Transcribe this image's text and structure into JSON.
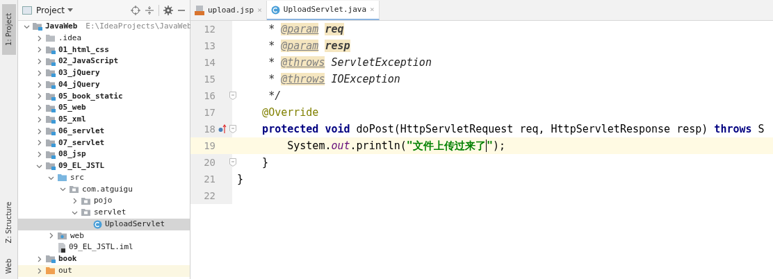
{
  "side_tabs": [
    {
      "label": "1: Project",
      "selected": true
    },
    {
      "label": "Z: Structure",
      "selected": false
    },
    {
      "label": "Web",
      "selected": false
    }
  ],
  "project_panel": {
    "title": "Project",
    "tree": [
      {
        "label": "JavaWeb",
        "path": "E:\\IdeaProjects\\JavaWeb",
        "kind": "module",
        "expanded": true,
        "selected": false,
        "children": [
          {
            "label": ".idea",
            "kind": "folder",
            "expanded": false,
            "selected": false
          },
          {
            "label": "01_html_css",
            "kind": "module",
            "expanded": false,
            "selected": false
          },
          {
            "label": "02_JavaScript",
            "kind": "module",
            "expanded": false,
            "selected": false
          },
          {
            "label": "03_jQuery",
            "kind": "module",
            "expanded": false,
            "selected": false
          },
          {
            "label": "04_jQuery",
            "kind": "module",
            "expanded": false,
            "selected": false
          },
          {
            "label": "05_book_static",
            "kind": "module",
            "expanded": false,
            "selected": false
          },
          {
            "label": "05_web",
            "kind": "module",
            "expanded": false,
            "selected": false
          },
          {
            "label": "05_xml",
            "kind": "module",
            "expanded": false,
            "selected": false
          },
          {
            "label": "06_servlet",
            "kind": "module",
            "expanded": false,
            "selected": false
          },
          {
            "label": "07_servlet",
            "kind": "module",
            "expanded": false,
            "selected": false
          },
          {
            "label": "08_jsp",
            "kind": "module",
            "expanded": false,
            "selected": false
          },
          {
            "label": "09_EL_JSTL",
            "kind": "module",
            "expanded": true,
            "selected": false,
            "children": [
              {
                "label": "src",
                "kind": "source",
                "expanded": true,
                "selected": false,
                "children": [
                  {
                    "label": "com.atguigu",
                    "kind": "package",
                    "expanded": true,
                    "selected": false,
                    "children": [
                      {
                        "label": "pojo",
                        "kind": "package",
                        "expanded": false,
                        "selected": false
                      },
                      {
                        "label": "servlet",
                        "kind": "package",
                        "expanded": true,
                        "selected": false,
                        "children": [
                          {
                            "label": "UploadServlet",
                            "kind": "class",
                            "selected": true
                          }
                        ]
                      }
                    ]
                  }
                ]
              },
              {
                "label": "web",
                "kind": "web",
                "expanded": false,
                "selected": false
              },
              {
                "label": "09_EL_JSTL.iml",
                "kind": "iml",
                "selected": false
              }
            ]
          },
          {
            "label": "book",
            "kind": "module",
            "expanded": false,
            "selected": false
          },
          {
            "label": "out",
            "kind": "excluded",
            "expanded": false,
            "selected": false
          }
        ]
      }
    ]
  },
  "editor": {
    "tabs": [
      {
        "label": "upload.jsp",
        "kind": "jsp",
        "selected": false,
        "close": "×"
      },
      {
        "label": "UploadServlet.java",
        "kind": "class",
        "selected": true,
        "close": "×"
      }
    ],
    "lines": [
      {
        "number": "12",
        "current": false,
        "fold": false,
        "override_mark": false,
        "tokens": [
          {
            "text": "     * ",
            "kind": "comment"
          },
          {
            "text": "@param",
            "kind": "doctag"
          },
          {
            "text": "req",
            "kind": "param",
            "space_before": true
          }
        ]
      },
      {
        "number": "13",
        "current": false,
        "fold": false,
        "override_mark": false,
        "tokens": [
          {
            "text": "     * ",
            "kind": "comment"
          },
          {
            "text": "@param",
            "kind": "doctag"
          },
          {
            "text": "resp",
            "kind": "param",
            "space_before": true
          }
        ]
      },
      {
        "number": "14",
        "current": false,
        "fold": false,
        "override_mark": false,
        "tokens": [
          {
            "text": "     * ",
            "kind": "comment"
          },
          {
            "text": "@throws",
            "kind": "doctag"
          },
          {
            "text": "ServletException",
            "kind": "doctype",
            "space_before": true
          }
        ]
      },
      {
        "number": "15",
        "current": false,
        "fold": false,
        "override_mark": false,
        "tokens": [
          {
            "text": "     * ",
            "kind": "comment"
          },
          {
            "text": "@throws",
            "kind": "doctag"
          },
          {
            "text": "IOException",
            "kind": "doctype",
            "space_before": true
          }
        ]
      },
      {
        "number": "16",
        "current": false,
        "fold": true,
        "override_mark": false,
        "tokens": [
          {
            "text": "     */",
            "kind": "comment"
          }
        ]
      },
      {
        "number": "17",
        "current": false,
        "fold": false,
        "override_mark": false,
        "tokens": [
          {
            "text": "    @Override",
            "kind": "annotation"
          }
        ]
      },
      {
        "number": "18",
        "current": false,
        "fold": true,
        "override_mark": true,
        "tokens": [
          {
            "text": "    protected void",
            "kind": "keyword"
          },
          {
            "text": " doPost(HttpServletRequest req, HttpServletResponse resp) ",
            "kind": "plain"
          },
          {
            "text": "throws",
            "kind": "keyword"
          },
          {
            "text": " S",
            "kind": "plain"
          }
        ]
      },
      {
        "number": "19",
        "current": true,
        "fold": false,
        "override_mark": false,
        "tokens": [
          {
            "text": "        System.",
            "kind": "plain"
          },
          {
            "text": "out",
            "kind": "field"
          },
          {
            "text": ".println(",
            "kind": "plain"
          },
          {
            "text": "\"文件上传过来了",
            "kind": "string"
          },
          {
            "text": "\"",
            "kind": "string",
            "caret_before": true
          },
          {
            "text": ");",
            "kind": "plain"
          }
        ]
      },
      {
        "number": "20",
        "current": false,
        "fold": true,
        "override_mark": false,
        "tokens": [
          {
            "text": "    }",
            "kind": "plain"
          }
        ]
      },
      {
        "number": "21",
        "current": false,
        "fold": false,
        "override_mark": false,
        "tokens": [
          {
            "text": "}",
            "kind": "plain"
          }
        ]
      },
      {
        "number": "22",
        "current": false,
        "fold": false,
        "override_mark": false
      }
    ]
  }
}
